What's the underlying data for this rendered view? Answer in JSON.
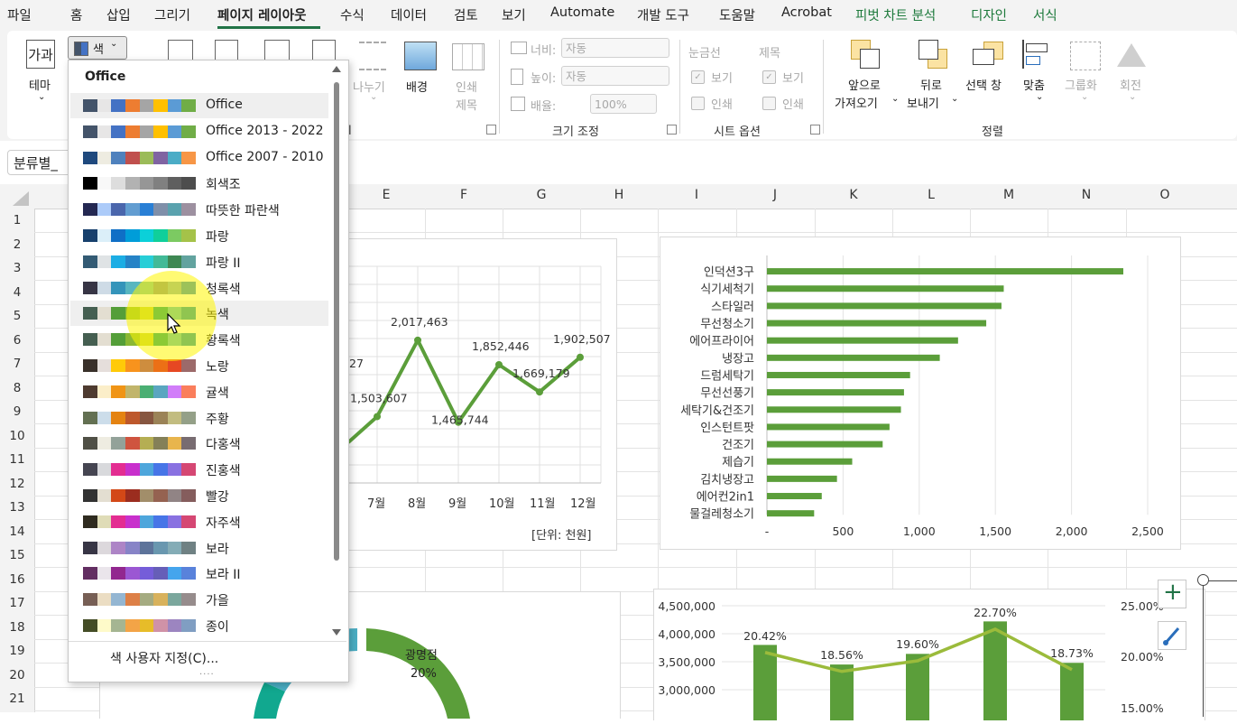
{
  "menu": {
    "tabs": [
      {
        "label": "파일",
        "state": ""
      },
      {
        "label": "홈",
        "state": ""
      },
      {
        "label": "삽입",
        "state": ""
      },
      {
        "label": "그리기",
        "state": ""
      },
      {
        "label": "페이지 레이아웃",
        "state": "active"
      },
      {
        "label": "수식",
        "state": ""
      },
      {
        "label": "데이터",
        "state": ""
      },
      {
        "label": "검토",
        "state": ""
      },
      {
        "label": "보기",
        "state": ""
      },
      {
        "label": "Automate",
        "state": ""
      },
      {
        "label": "개발 도구",
        "state": ""
      },
      {
        "label": "도움말",
        "state": ""
      },
      {
        "label": "Acrobat",
        "state": ""
      },
      {
        "label": "피벗 차트 분석",
        "state": "context"
      },
      {
        "label": "디자인",
        "state": "context"
      },
      {
        "label": "서식",
        "state": "context"
      }
    ]
  },
  "ribbon": {
    "themes": {
      "theme_label": "테마",
      "theme_icon_text": "가과",
      "colors_label": "색"
    },
    "page_setup": {
      "breaks_label": "나누기",
      "background_label": "배경",
      "print_titles_line1": "인쇄",
      "print_titles_line2": "제목"
    },
    "scale": {
      "width_label": "너비:",
      "width_value": "자동",
      "height_label": "높이:",
      "height_value": "자동",
      "scale_label": "배율:",
      "scale_value": "100%",
      "group_label": "크기 조정"
    },
    "sheet_options": {
      "gridlines_label": "눈금선",
      "headings_label": "제목",
      "view_label": "보기",
      "print_label": "인쇄",
      "group_label": "시트 옵션"
    },
    "arrange": {
      "bring_forward_line1": "앞으로",
      "bring_forward_line2": "가져오기",
      "send_backward_line1": "뒤로",
      "send_backward_line2": "보내기",
      "selection_pane": "선택 창",
      "align": "맞춤",
      "group": "그룹화",
      "rotate": "회전",
      "group_label": "정렬"
    }
  },
  "namebox": {
    "value": "분류별_"
  },
  "columns": [
    "E",
    "F",
    "G",
    "H",
    "I",
    "J",
    "K",
    "L",
    "M",
    "N",
    "O"
  ],
  "rows": [
    "1",
    "2",
    "3",
    "4",
    "5",
    "6",
    "7",
    "8",
    "9",
    "10",
    "11",
    "12",
    "13",
    "14",
    "15",
    "16",
    "17",
    "18",
    "19",
    "20",
    "21"
  ],
  "color_dropdown": {
    "header": "Office",
    "custom_label": "색 사용자 지정(C)...",
    "grip": "....",
    "schemes": [
      {
        "name": "Office",
        "colors": [
          "#44546A",
          "#E7E6E6",
          "#4472C4",
          "#ED7D31",
          "#A5A5A5",
          "#FFC000",
          "#5B9BD5",
          "#70AD47"
        ]
      },
      {
        "name": "Office 2013 - 2022",
        "colors": [
          "#44546A",
          "#E7E6E6",
          "#4472C4",
          "#ED7D31",
          "#A5A5A5",
          "#FFC000",
          "#5B9BD5",
          "#70AD47"
        ]
      },
      {
        "name": "Office 2007 - 2010",
        "colors": [
          "#1F497D",
          "#EEECE1",
          "#4F81BD",
          "#C0504D",
          "#9BBB59",
          "#8064A2",
          "#4BACC6",
          "#F79646"
        ]
      },
      {
        "name": "회색조",
        "colors": [
          "#000000",
          "#F8F8F8",
          "#DDDDDD",
          "#B2B2B2",
          "#969696",
          "#808080",
          "#5F5F5F",
          "#4D4D4D"
        ]
      },
      {
        "name": "따뜻한 파란색",
        "colors": [
          "#242852",
          "#ACCBF9",
          "#4A66AC",
          "#629DD1",
          "#297FD5",
          "#7F8FA9",
          "#5AA2AE",
          "#9D90A0"
        ]
      },
      {
        "name": "파랑",
        "colors": [
          "#17406D",
          "#DBEFF9",
          "#0F6FC6",
          "#009DD9",
          "#0BD0D9",
          "#10CF9B",
          "#7CCA62",
          "#A5C249"
        ]
      },
      {
        "name": "파랑 II",
        "colors": [
          "#335B74",
          "#DFE3E5",
          "#1CADE4",
          "#2683C6",
          "#27CED7",
          "#42BA97",
          "#3E8853",
          "#62A39F"
        ]
      },
      {
        "name": "청록색",
        "colors": [
          "#373545",
          "#CEDBE6",
          "#3494BA",
          "#58B6C0",
          "#75BDA7",
          "#7A8C8E",
          "#84ACB6",
          "#2683C6"
        ]
      },
      {
        "name": "녹색",
        "colors": [
          "#455F51",
          "#E3DED1",
          "#549E39",
          "#8AB833",
          "#C0CF3A",
          "#029676",
          "#4AB5C4",
          "#0989B1"
        ]
      },
      {
        "name": "황록색",
        "colors": [
          "#455F51",
          "#E3DED1",
          "#549E39",
          "#8AB833",
          "#C0CF3A",
          "#029676",
          "#4AB5C4",
          "#0989B1"
        ]
      },
      {
        "name": "노랑",
        "colors": [
          "#39302A",
          "#E5DEDB",
          "#FFCA08",
          "#F8931D",
          "#CE8D3E",
          "#EC7016",
          "#E64823",
          "#9C6A6A"
        ]
      },
      {
        "name": "귤색",
        "colors": [
          "#4E3B30",
          "#FBEEC9",
          "#F09415",
          "#C1B56B",
          "#4BAF73",
          "#5AA6C0",
          "#D17DF9",
          "#FA7E5C"
        ]
      },
      {
        "name": "주황",
        "colors": [
          "#637052",
          "#CCDDEA",
          "#E48312",
          "#BD582C",
          "#865640",
          "#9B8357",
          "#C2BC80",
          "#94A088"
        ]
      },
      {
        "name": "다홍색",
        "colors": [
          "#505046",
          "#EEECE1",
          "#93A299",
          "#CF543F",
          "#B5AE53",
          "#848058",
          "#E8B54D",
          "#786C71"
        ]
      },
      {
        "name": "진홍색",
        "colors": [
          "#454551",
          "#D8D9DC",
          "#E32D91",
          "#C830CC",
          "#4EA6DC",
          "#4775E7",
          "#8971E1",
          "#D54773"
        ]
      },
      {
        "name": "빨강",
        "colors": [
          "#323232",
          "#E3DED1",
          "#D34817",
          "#9B2D1F",
          "#A28E6A",
          "#956251",
          "#918485",
          "#855D5D"
        ]
      },
      {
        "name": "자주색",
        "colors": [
          "#2F2B20",
          "#DFDCB7",
          "#E32D91",
          "#C830CC",
          "#4EA6DC",
          "#4775E7",
          "#8971E1",
          "#D54773"
        ]
      },
      {
        "name": "보라",
        "colors": [
          "#373545",
          "#DCD8DC",
          "#AD84C6",
          "#8784C7",
          "#5D739A",
          "#6997AF",
          "#84ACB6",
          "#6F8183"
        ]
      },
      {
        "name": "보라 II",
        "colors": [
          "#632E62",
          "#EAE5EB",
          "#92278F",
          "#9B57D3",
          "#755DD9",
          "#665EB8",
          "#45A5ED",
          "#5982DB"
        ]
      },
      {
        "name": "가을",
        "colors": [
          "#775F55",
          "#EBDDC3",
          "#94B6D2",
          "#DD8047",
          "#A5AB81",
          "#D8B25C",
          "#7BA79D",
          "#968C8C"
        ]
      },
      {
        "name": "종이",
        "colors": [
          "#444D26",
          "#FEFAC9",
          "#A5B592",
          "#F3A447",
          "#E7BC29",
          "#D092A7",
          "#9C85C0",
          "#809EC2"
        ]
      }
    ]
  },
  "line_chart": {
    "chart_data": {
      "type": "line",
      "x": [
        "7월",
        "8월",
        "9월",
        "10월",
        "11월",
        "12월"
      ],
      "values": [
        1503607,
        2017463,
        1465744,
        1852446,
        1669179,
        1902507
      ],
      "value_labels": [
        "1,503,607",
        "2,017,463",
        "1,465,744",
        "1,852,446",
        "1,669,179",
        "1,902,507"
      ],
      "partial_label": "27",
      "unit_label": "[단위: 천원]",
      "color": "#5B9E3A"
    }
  },
  "bar_chart": {
    "chart_data": {
      "type": "bar",
      "orientation": "horizontal",
      "categories": [
        "인덕션3구",
        "식기세척기",
        "스타일러",
        "무선청소기",
        "에어프라이어",
        "냉장고",
        "드럼세탁기",
        "무선선풍기",
        "세탁기&건조기",
        "인스턴트팟",
        "건조기",
        "제습기",
        "김치냉장고",
        "에어컨2in1",
        "물걸레청소기"
      ],
      "values": [
        2340,
        1555,
        1540,
        1440,
        1255,
        1135,
        940,
        900,
        880,
        805,
        760,
        560,
        460,
        360,
        310
      ],
      "xlim": [
        0,
        2500
      ],
      "ticks": [
        "-",
        "500",
        "1,000",
        "1,500",
        "2,000",
        "2,500"
      ],
      "color": "#5B9E3A"
    }
  },
  "combo_chart": {
    "chart_data": {
      "type": "bar",
      "left_ticks": [
        "4,500,000",
        "4,000,000",
        "3,500,000",
        "3,000,000"
      ],
      "right_ticks": [
        "25.00%",
        "20.00%",
        "15.00%"
      ],
      "bar_values": [
        3800000,
        3450000,
        3640000,
        4220000,
        3480000
      ],
      "percent_labels": [
        "20.42%",
        "18.56%",
        "19.60%",
        "22.70%",
        "18.73%"
      ],
      "percent_values": [
        20.42,
        18.56,
        19.6,
        22.7,
        18.73
      ],
      "bar_color": "#5B9E3A",
      "line_color": "#9BBB3B"
    }
  },
  "donut_chart": {
    "slice_label": "광명점",
    "slice_percent": "20%"
  }
}
